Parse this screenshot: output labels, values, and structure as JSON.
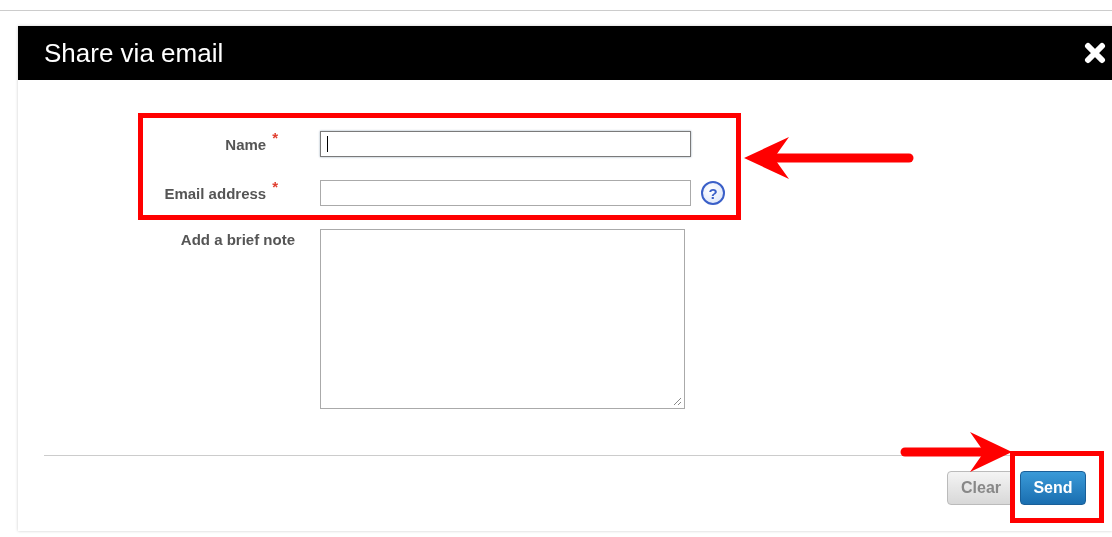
{
  "dialog": {
    "title": "Share via email"
  },
  "fields": [
    {
      "kind": "input",
      "label": "Name",
      "required_mark": "*",
      "focused": true
    },
    {
      "kind": "input",
      "label": "Email address",
      "required_mark": "*",
      "focused": false,
      "help": true
    },
    {
      "kind": "textarea",
      "label": "Add a brief note",
      "focused": false
    }
  ],
  "help_glyph": "?",
  "buttons": [
    {
      "label": "Clear",
      "kind": "secondary"
    },
    {
      "label": "Send",
      "kind": "primary"
    }
  ]
}
